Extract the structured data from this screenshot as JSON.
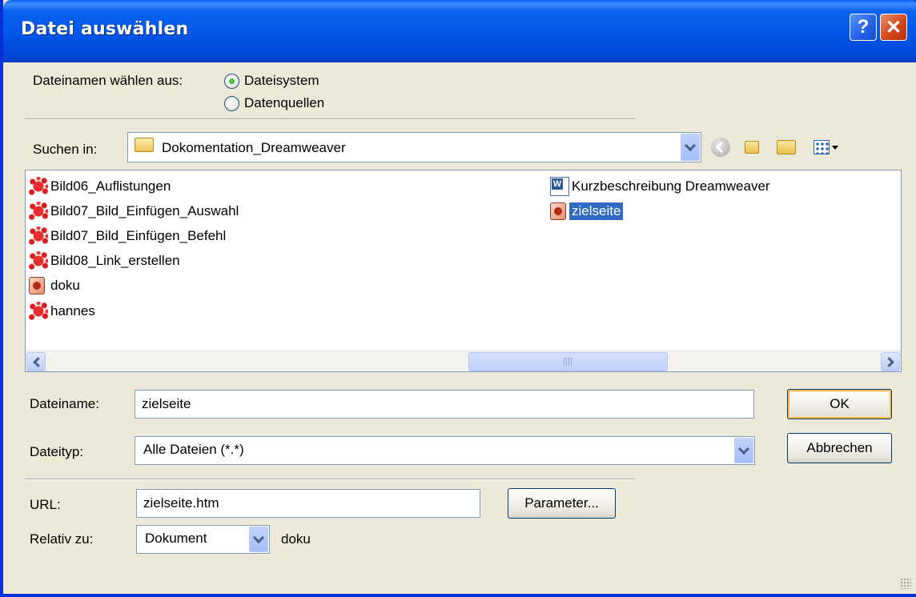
{
  "window": {
    "title": "Datei auswählen",
    "help_label": "?",
    "close_label": "✕"
  },
  "source": {
    "label": "Dateinamen wählen aus:",
    "options": [
      {
        "label": "Dateisystem",
        "selected": true
      },
      {
        "label": "Datenquellen",
        "selected": false
      }
    ]
  },
  "look_in": {
    "label": "Suchen in:",
    "value": "Dokomentation_Dreamweaver",
    "icons": [
      "back-icon",
      "up-folder-icon",
      "new-folder-icon",
      "view-menu-icon"
    ]
  },
  "files": {
    "left": [
      {
        "name": "Bild06_Auflistungen",
        "icon": "image-splat-icon"
      },
      {
        "name": "Bild07_Bild_Einfügen_Auswahl",
        "icon": "image-splat-icon"
      },
      {
        "name": "Bild07_Bild_Einfügen_Befehl",
        "icon": "image-splat-icon"
      },
      {
        "name": "Bild08_Link_erstellen",
        "icon": "image-splat-icon"
      },
      {
        "name": "doku",
        "icon": "dreamweaver-doc-icon"
      },
      {
        "name": "hannes",
        "icon": "image-splat-icon"
      }
    ],
    "right": [
      {
        "name": "Kurzbeschreibung Dreamweaver",
        "icon": "word-doc-icon",
        "selected": false
      },
      {
        "name": "zielseite",
        "icon": "dreamweaver-doc-icon",
        "selected": true
      }
    ]
  },
  "filename": {
    "label": "Dateiname:",
    "value": "zielseite"
  },
  "filetype": {
    "label": "Dateityp:",
    "value": "Alle Dateien (*.*)"
  },
  "buttons": {
    "ok": "OK",
    "cancel": "Abbrechen",
    "params": "Parameter..."
  },
  "url": {
    "label": "URL:",
    "value": "zielseite.htm"
  },
  "relative": {
    "label": "Relativ zu:",
    "value": "Dokument",
    "doc": "doku"
  }
}
